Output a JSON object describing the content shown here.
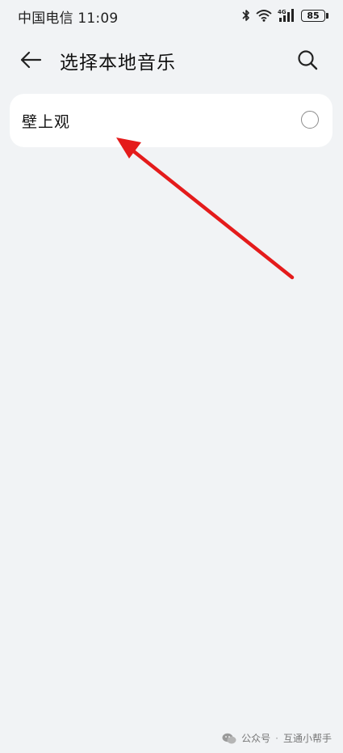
{
  "status_bar": {
    "carrier_time": "中国电信 11:09",
    "battery": "85",
    "network": "4G"
  },
  "header": {
    "title": "选择本地音乐",
    "back_icon": "back-arrow-icon",
    "search_icon": "search-icon"
  },
  "list": {
    "items": [
      {
        "label": "壁上观",
        "selected": false
      }
    ]
  },
  "annotation": {
    "color": "#e41b1b"
  },
  "watermark": {
    "prefix": "公众号",
    "separator": "·",
    "name": "互通小帮手"
  }
}
